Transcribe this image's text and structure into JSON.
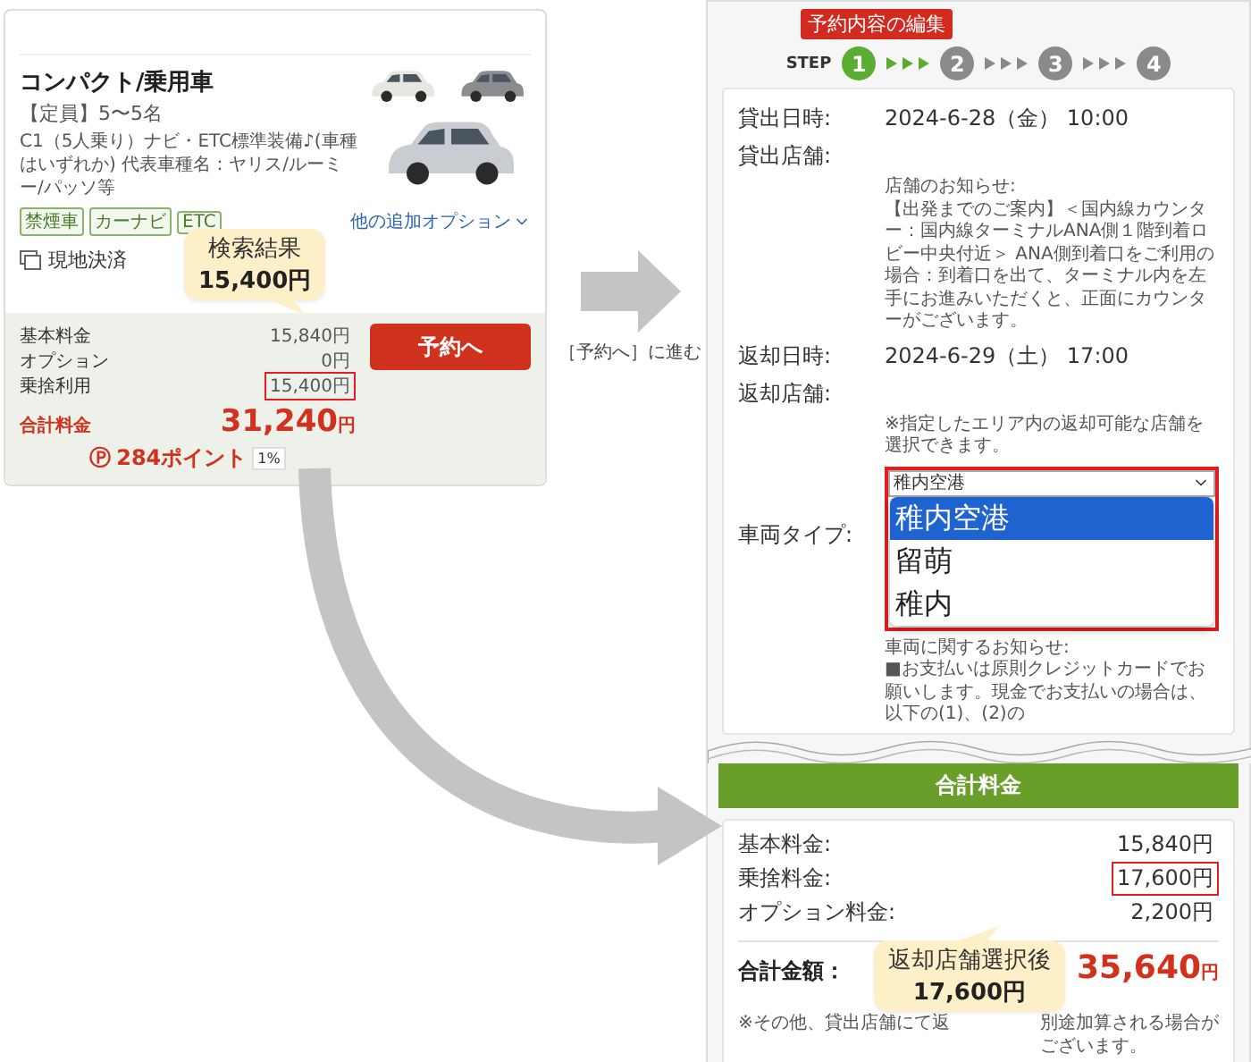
{
  "search_result_card": {
    "category": "コンパクト/乗用車",
    "capacity": "【定員】5〜5名",
    "description": "C1（5人乗り）ナビ・ETC標準装備♪(車種はいずれか) 代表車種名：ヤリス/ルーミー/パッソ等",
    "tags": [
      "禁煙車",
      "カーナビ",
      "ETC"
    ],
    "options_link": "他の追加オプション",
    "payment": "現地決済",
    "prices": [
      {
        "label": "基本料金",
        "value": "15,840円",
        "highlighted": false
      },
      {
        "label": "オプション",
        "value": "0円",
        "highlighted": false
      },
      {
        "label": "乗捨利用",
        "value": "15,400円",
        "highlighted": true
      }
    ],
    "total_label": "合計料金",
    "total_value": "31,240",
    "total_unit": "円",
    "points_mark": "Ⓟ",
    "points": "284ポイント",
    "point_rate": "1%",
    "reserve_button": "予約へ",
    "callout": {
      "title": "検索結果",
      "amount": "15,400円"
    }
  },
  "transition": {
    "caption": "［予約へ］に進む"
  },
  "edit_panel": {
    "badge": "予約内容の編集",
    "step_label": "STEP",
    "steps": [
      {
        "number": "1",
        "selected": true
      },
      {
        "number": "2",
        "selected": false
      },
      {
        "number": "3",
        "selected": false
      },
      {
        "number": "4",
        "selected": false
      }
    ],
    "pickup": {
      "datetime_label": "貸出日時:",
      "datetime": "2024-6-28（金） 10:00",
      "store_label": "貸出店舗:",
      "notice_title": "店舗のお知らせ:",
      "notice": "【出発までのご案内】＜国内線カウンター：国内線ターミナルANA側１階到着ロビー中央付近＞ ANA側到着口をご利用の場合：到着口を出て、ターミナル内を左手にお進みいただくと、正面にカウンターがございます。"
    },
    "return": {
      "datetime_label": "返却日時:",
      "datetime": "2024-6-29（土） 17:00",
      "store_label": "返却店舗:",
      "hint": "※指定したエリア内の返却可能な店舗を選択できます。",
      "select_value": "稚内空港",
      "options": [
        {
          "label": "稚内空港",
          "selected": true
        },
        {
          "label": "留萌",
          "selected": false
        },
        {
          "label": "稚内",
          "selected": false
        }
      ]
    },
    "vehicle": {
      "label": "車両タイプ:",
      "notice_title": "車両に関するお知らせ:",
      "notice": "■お支払いは原則クレジットカードでお願いします。現金でお支払いの場合は、以下の(1)、(2)の"
    },
    "summary": {
      "title": "合計料金",
      "rows": [
        {
          "label": "基本料金:",
          "value": "15,840円",
          "highlighted": false
        },
        {
          "label": "乗捨料金:",
          "value": "17,600円",
          "highlighted": true
        },
        {
          "label": "オプション料金:",
          "value": "2,200円",
          "highlighted": false
        }
      ],
      "total_label": "合計金額：",
      "total_value": "35,640",
      "total_unit": "円",
      "notice_start": "※その他、貸出店舗にて返",
      "notice_end": "別途加算される場合がございます。",
      "callout": {
        "title": "返却店舗選択後",
        "amount": "17,600円"
      }
    }
  }
}
